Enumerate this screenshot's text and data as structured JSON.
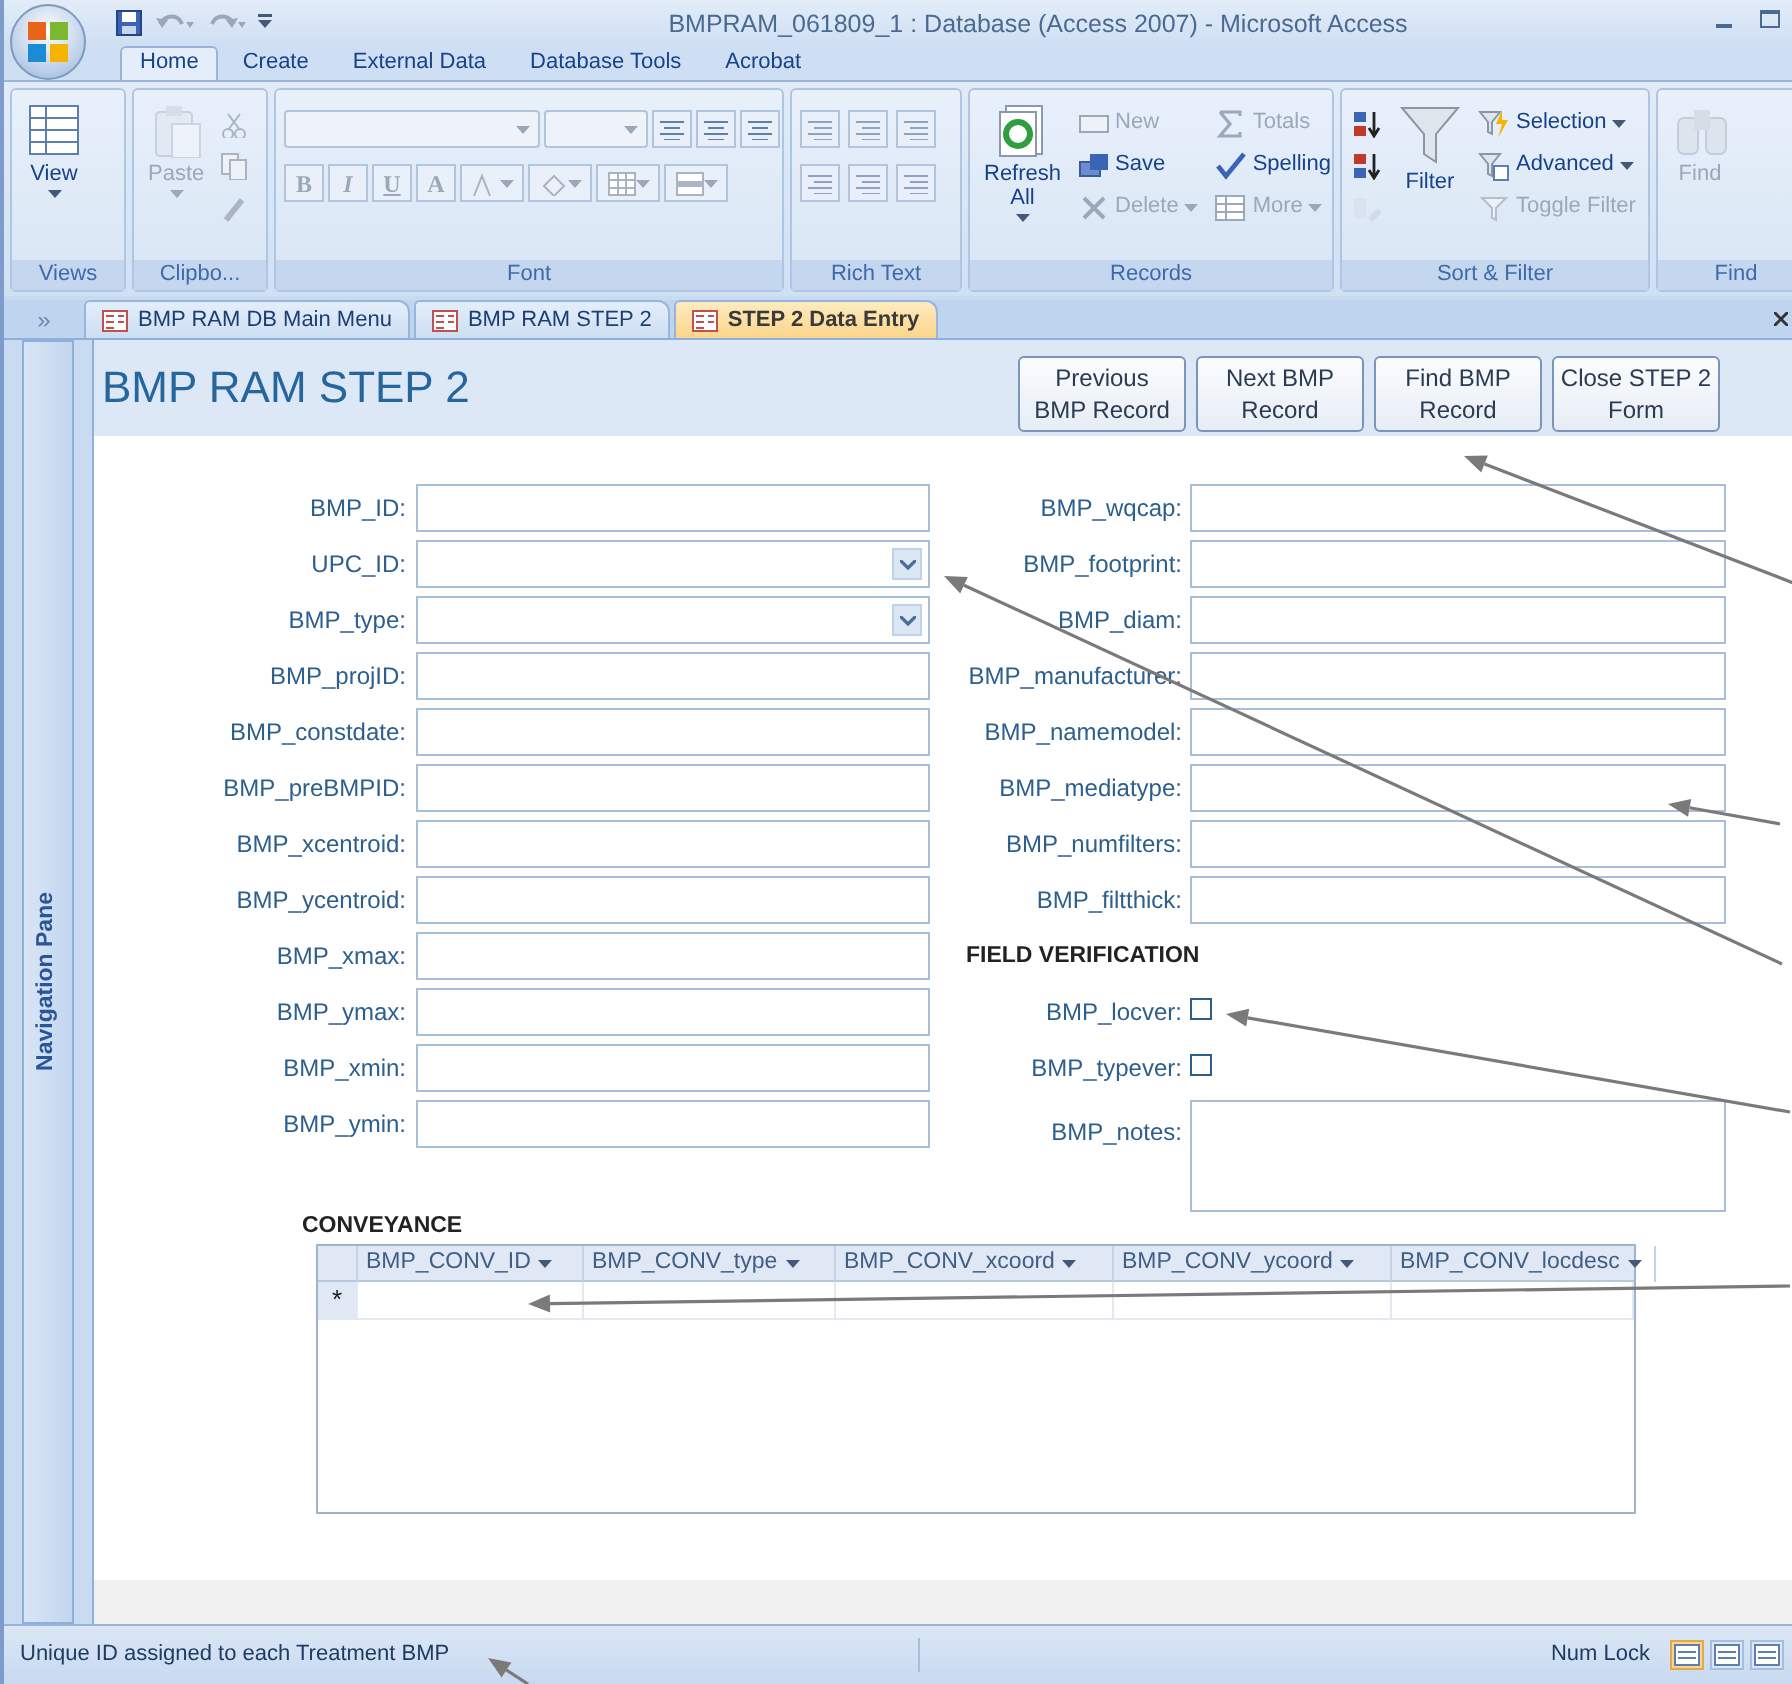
{
  "window": {
    "title": "BMPRAM_061809_1 : Database (Access 2007) - Microsoft Access"
  },
  "ribbon_tabs": [
    {
      "label": "Home",
      "selected": true
    },
    {
      "label": "Create",
      "selected": false
    },
    {
      "label": "External Data",
      "selected": false
    },
    {
      "label": "Database Tools",
      "selected": false
    },
    {
      "label": "Acrobat",
      "selected": false
    }
  ],
  "ribbon_groups": [
    {
      "label": "Views",
      "items": [
        {
          "kind": "large",
          "label": "View",
          "disabled": false,
          "dropdown": true
        }
      ]
    },
    {
      "label": "Clipbo...",
      "items": [
        {
          "kind": "large",
          "label": "Paste",
          "disabled": true,
          "dropdown": true
        }
      ]
    },
    {
      "label": "Font",
      "items": [
        {
          "kind": "format",
          "label": "B",
          "disabled": true
        },
        {
          "kind": "format",
          "label": "I",
          "disabled": true
        },
        {
          "kind": "format",
          "label": "U",
          "disabled": true
        },
        {
          "kind": "format",
          "label": "A",
          "disabled": true
        }
      ]
    },
    {
      "label": "Rich Text"
    },
    {
      "label": "Records",
      "items": [
        {
          "kind": "large",
          "label": "Refresh All",
          "disabled": false,
          "dropdown": true
        },
        {
          "kind": "small",
          "label": "New",
          "disabled": true,
          "dropdown": false
        },
        {
          "kind": "small",
          "label": "Save",
          "disabled": false,
          "dropdown": false
        },
        {
          "kind": "small",
          "label": "Delete",
          "disabled": true,
          "dropdown": true
        },
        {
          "kind": "small",
          "label": "Totals",
          "disabled": true,
          "dropdown": false
        },
        {
          "kind": "small",
          "label": "Spelling",
          "disabled": false,
          "dropdown": false
        },
        {
          "kind": "small",
          "label": "More",
          "disabled": true,
          "dropdown": true
        }
      ]
    },
    {
      "label": "Sort & Filter",
      "items": [
        {
          "kind": "icon",
          "disabled": false
        },
        {
          "kind": "icon",
          "disabled": false
        },
        {
          "kind": "icon",
          "disabled": true
        },
        {
          "kind": "large",
          "label": "Filter",
          "disabled": false,
          "dropdown": false
        },
        {
          "kind": "small",
          "label": "Selection",
          "disabled": false,
          "dropdown": true
        },
        {
          "kind": "small",
          "label": "Advanced",
          "disabled": false,
          "dropdown": true
        },
        {
          "kind": "small",
          "label": "Toggle Filter",
          "disabled": true,
          "dropdown": false
        }
      ]
    },
    {
      "label": "Find",
      "items": [
        {
          "kind": "large",
          "label": "Find",
          "disabled": true,
          "dropdown": false
        }
      ]
    }
  ],
  "navigation_pane": {
    "toggle": "»",
    "label": "Navigation Pane"
  },
  "document_tabs": [
    {
      "label": "BMP RAM DB Main Menu",
      "selected": false
    },
    {
      "label": "BMP RAM STEP 2",
      "selected": false
    },
    {
      "label": "STEP 2 Data Entry",
      "selected": true
    }
  ],
  "form": {
    "title": "BMP RAM STEP 2",
    "buttons": [
      {
        "lines": [
          "Previous",
          "BMP Record"
        ]
      },
      {
        "lines": [
          "Next BMP",
          "Record"
        ]
      },
      {
        "lines": [
          "Find BMP",
          "Record"
        ]
      },
      {
        "lines": [
          "Close STEP 2",
          "Form"
        ]
      }
    ],
    "left_fields": [
      {
        "kind": "text",
        "label": "BMP_ID:"
      },
      {
        "kind": "combo",
        "label": "UPC_ID:"
      },
      {
        "kind": "combo",
        "label": "BMP_type:"
      },
      {
        "kind": "text",
        "label": "BMP_projID:"
      },
      {
        "kind": "text",
        "label": "BMP_constdate:"
      },
      {
        "kind": "text",
        "label": "BMP_preBMPID:"
      },
      {
        "kind": "text",
        "label": "BMP_xcentroid:"
      },
      {
        "kind": "text",
        "label": "BMP_ycentroid:"
      },
      {
        "kind": "text",
        "label": "BMP_xmax:"
      },
      {
        "kind": "text",
        "label": "BMP_ymax:"
      },
      {
        "kind": "text",
        "label": "BMP_xmin:"
      },
      {
        "kind": "text",
        "label": "BMP_ymin:"
      }
    ],
    "right_fields": [
      {
        "kind": "text",
        "label": "BMP_wqcap:"
      },
      {
        "kind": "text",
        "label": "BMP_footprint:"
      },
      {
        "kind": "text",
        "label": "BMP_diam:"
      },
      {
        "kind": "text",
        "label": "BMP_manufacturer:"
      },
      {
        "kind": "text",
        "label": "BMP_namemodel:"
      },
      {
        "kind": "text",
        "label": "BMP_mediatype:"
      },
      {
        "kind": "text",
        "label": "BMP_numfilters:"
      },
      {
        "kind": "text",
        "label": "BMP_filtthick:"
      },
      {
        "kind": "heading",
        "label": "FIELD VERIFICATION"
      },
      {
        "kind": "checkbox",
        "label": "BMP_locver:",
        "checked": false
      },
      {
        "kind": "checkbox",
        "label": "BMP_typever:",
        "checked": false
      },
      {
        "kind": "memo",
        "label": "BMP_notes:"
      }
    ],
    "subform": {
      "heading": "CONVEYANCE",
      "columns": [
        "BMP_CONV_ID",
        "BMP_CONV_type",
        "BMP_CONV_xcoord",
        "BMP_CONV_ycoord",
        "BMP_CONV_locdesc"
      ],
      "new_row_marker": "*"
    }
  },
  "status_bar": {
    "message": "Unique ID assigned to each Treatment BMP",
    "indicator": "Num Lock"
  }
}
